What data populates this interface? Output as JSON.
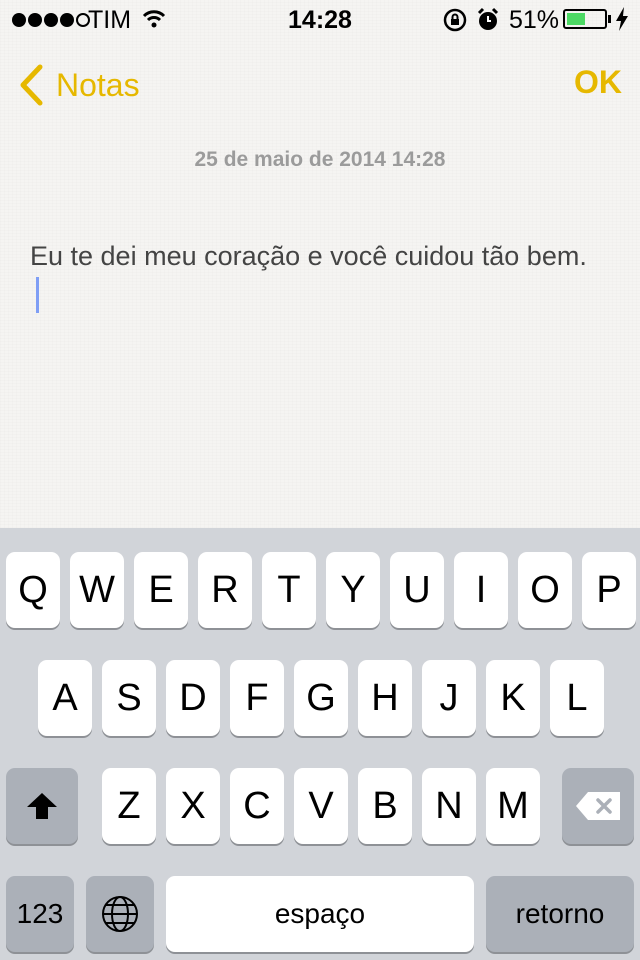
{
  "status": {
    "carrier": "TIM",
    "time": "14:28",
    "battery_percent": "51%",
    "battery_level": 0.51
  },
  "nav": {
    "back_label": "Notas",
    "done_label": "OK"
  },
  "note": {
    "date": "25 de maio de 2014 14:28",
    "text": "Eu te dei meu coração e você cuidou tão bem."
  },
  "keyboard": {
    "row1": [
      "Q",
      "W",
      "E",
      "R",
      "T",
      "Y",
      "U",
      "I",
      "O",
      "P"
    ],
    "row2": [
      "A",
      "S",
      "D",
      "F",
      "G",
      "H",
      "J",
      "K",
      "L"
    ],
    "row3": [
      "Z",
      "X",
      "C",
      "V",
      "B",
      "N",
      "M"
    ],
    "numbers_label": "123",
    "space_label": "espaço",
    "return_label": "retorno",
    "icons": [
      "shift-icon",
      "backspace-icon",
      "globe-icon"
    ]
  },
  "colors": {
    "accent": "#e6b800",
    "caret": "#7f9ef5",
    "battery": "#4cd964"
  }
}
